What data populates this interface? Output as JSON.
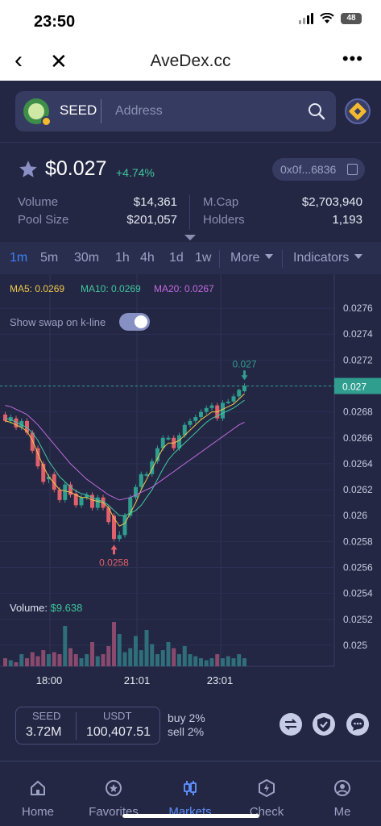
{
  "status_bar": {
    "time": "23:50",
    "battery": "48"
  },
  "browser": {
    "title": "AveDex.cc",
    "back_icon": "chevron-left-icon",
    "close_icon": "close-icon",
    "more_label": "•••"
  },
  "search": {
    "token": "SEED",
    "placeholder": "Address"
  },
  "price": {
    "value": "$0.027",
    "change": "+4.74%",
    "address": "0x0f...6836"
  },
  "stats": {
    "volume_label": "Volume",
    "volume": "$14,361",
    "pool_label": "Pool Size",
    "pool": "$201,057",
    "mcap_label": "M.Cap",
    "mcap": "$2,703,940",
    "holders_label": "Holders",
    "holders": "1,193"
  },
  "tabs": {
    "items": [
      "1m",
      "5m",
      "30m",
      "1h",
      "4h",
      "1d",
      "1w"
    ],
    "active": "1m",
    "more": "More",
    "indicators": "Indicators"
  },
  "chart": {
    "ma5": "MA5: 0.0269",
    "ma10": "MA10: 0.0269",
    "ma20": "MA20: 0.0267",
    "swap_label": "Show swap on k-line",
    "swap_toggle_on": true,
    "volume_prefix": "Volume: ",
    "volume_value": "$9.638",
    "high_marker": "0.027",
    "low_marker": "0.0258",
    "current_tag": "0.027",
    "colors": {
      "up": "#2f9e8f",
      "down": "#e0606b",
      "ma5": "#f0c94a",
      "ma10": "#41c8a0",
      "ma20": "#c26ae0"
    }
  },
  "chart_data": {
    "type": "candlestick",
    "y_ticks": [
      "0.0276",
      "0.0274",
      "0.0272",
      "0.0270",
      "0.0268",
      "0.0266",
      "0.0264",
      "0.0262",
      "0.026",
      "0.0258",
      "0.0256",
      "0.0254",
      "0.0252",
      "0.025"
    ],
    "x_ticks": [
      "18:00",
      "21:01",
      "23:01"
    ],
    "candles": [
      {
        "o": 0.02678,
        "c": 0.02673,
        "h": 0.0268,
        "l": 0.02672
      },
      {
        "o": 0.02673,
        "c": 0.02676,
        "h": 0.02678,
        "l": 0.02671
      },
      {
        "o": 0.02675,
        "c": 0.02668,
        "h": 0.02677,
        "l": 0.02666
      },
      {
        "o": 0.02668,
        "c": 0.02673,
        "h": 0.02675,
        "l": 0.02666
      },
      {
        "o": 0.02673,
        "c": 0.02664,
        "h": 0.02675,
        "l": 0.02662
      },
      {
        "o": 0.02664,
        "c": 0.0265,
        "h": 0.02666,
        "l": 0.02648
      },
      {
        "o": 0.02652,
        "c": 0.02638,
        "h": 0.02654,
        "l": 0.02636
      },
      {
        "o": 0.0264,
        "c": 0.02626,
        "h": 0.02642,
        "l": 0.02624
      },
      {
        "o": 0.02628,
        "c": 0.0263,
        "h": 0.02632,
        "l": 0.02625
      },
      {
        "o": 0.02632,
        "c": 0.0262,
        "h": 0.02634,
        "l": 0.02618
      },
      {
        "o": 0.0262,
        "c": 0.02612,
        "h": 0.02622,
        "l": 0.0261
      },
      {
        "o": 0.02612,
        "c": 0.02624,
        "h": 0.02626,
        "l": 0.0261
      },
      {
        "o": 0.02624,
        "c": 0.02616,
        "h": 0.02626,
        "l": 0.02614
      },
      {
        "o": 0.02617,
        "c": 0.02608,
        "h": 0.0262,
        "l": 0.02606
      },
      {
        "o": 0.02608,
        "c": 0.02614,
        "h": 0.02616,
        "l": 0.02606
      },
      {
        "o": 0.02614,
        "c": 0.02616,
        "h": 0.02618,
        "l": 0.02612
      },
      {
        "o": 0.02616,
        "c": 0.02606,
        "h": 0.02618,
        "l": 0.02604
      },
      {
        "o": 0.02606,
        "c": 0.02614,
        "h": 0.02616,
        "l": 0.02604
      },
      {
        "o": 0.02614,
        "c": 0.02606,
        "h": 0.02616,
        "l": 0.02604
      },
      {
        "o": 0.02606,
        "c": 0.02595,
        "h": 0.02608,
        "l": 0.02593
      },
      {
        "o": 0.026,
        "c": 0.02582,
        "h": 0.02602,
        "l": 0.0258
      },
      {
        "o": 0.02582,
        "c": 0.02585,
        "h": 0.02588,
        "l": 0.0258
      },
      {
        "o": 0.02585,
        "c": 0.026,
        "h": 0.02602,
        "l": 0.02583
      },
      {
        "o": 0.026,
        "c": 0.02614,
        "h": 0.02616,
        "l": 0.02598
      },
      {
        "o": 0.02614,
        "c": 0.02622,
        "h": 0.02624,
        "l": 0.02612
      },
      {
        "o": 0.02622,
        "c": 0.02632,
        "h": 0.02634,
        "l": 0.0262
      },
      {
        "o": 0.02632,
        "c": 0.02632,
        "h": 0.02634,
        "l": 0.0263
      },
      {
        "o": 0.02632,
        "c": 0.02642,
        "h": 0.02644,
        "l": 0.0263
      },
      {
        "o": 0.02642,
        "c": 0.02652,
        "h": 0.02654,
        "l": 0.0264
      },
      {
        "o": 0.02652,
        "c": 0.0266,
        "h": 0.02662,
        "l": 0.0265
      },
      {
        "o": 0.0266,
        "c": 0.0266,
        "h": 0.02662,
        "l": 0.02658
      },
      {
        "o": 0.0266,
        "c": 0.02652,
        "h": 0.02662,
        "l": 0.0265
      },
      {
        "o": 0.02652,
        "c": 0.02662,
        "h": 0.02664,
        "l": 0.0265
      },
      {
        "o": 0.02662,
        "c": 0.0267,
        "h": 0.02672,
        "l": 0.0266
      },
      {
        "o": 0.0267,
        "c": 0.02673,
        "h": 0.02675,
        "l": 0.02668
      },
      {
        "o": 0.02673,
        "c": 0.02676,
        "h": 0.02678,
        "l": 0.02671
      },
      {
        "o": 0.02676,
        "c": 0.0268,
        "h": 0.02682,
        "l": 0.02674
      },
      {
        "o": 0.0268,
        "c": 0.02683,
        "h": 0.02685,
        "l": 0.02678
      },
      {
        "o": 0.02683,
        "c": 0.02685,
        "h": 0.02687,
        "l": 0.02681
      },
      {
        "o": 0.02685,
        "c": 0.02675,
        "h": 0.02687,
        "l": 0.02673
      },
      {
        "o": 0.02675,
        "c": 0.02687,
        "h": 0.02689,
        "l": 0.02673
      },
      {
        "o": 0.02687,
        "c": 0.02688,
        "h": 0.0269,
        "l": 0.02686
      },
      {
        "o": 0.02688,
        "c": 0.02692,
        "h": 0.02694,
        "l": 0.02686
      },
      {
        "o": 0.02692,
        "c": 0.02697,
        "h": 0.02698,
        "l": 0.0269
      },
      {
        "o": 0.02696,
        "c": 0.027,
        "h": 0.02702,
        "l": 0.02695
      }
    ],
    "ma5": [
      0.02673,
      0.02672,
      0.0267,
      0.02668,
      0.02665,
      0.02658,
      0.02648,
      0.02638,
      0.0263,
      0.02625,
      0.0262,
      0.02619,
      0.02618,
      0.02616,
      0.02614,
      0.02614,
      0.02612,
      0.02611,
      0.0261,
      0.02606,
      0.02598,
      0.02592,
      0.02594,
      0.02602,
      0.0261,
      0.0262,
      0.02628,
      0.02636,
      0.02644,
      0.02652,
      0.02656,
      0.02656,
      0.02658,
      0.02662,
      0.02666,
      0.0267,
      0.02674,
      0.02677,
      0.0268,
      0.0268,
      0.02682,
      0.02684,
      0.02686,
      0.0269,
      0.02694
    ],
    "ma10": [
      0.02675,
      0.02674,
      0.02672,
      0.0267,
      0.02668,
      0.02664,
      0.02658,
      0.0265,
      0.02642,
      0.02636,
      0.0263,
      0.02626,
      0.02622,
      0.02619,
      0.02617,
      0.02616,
      0.02614,
      0.02612,
      0.02611,
      0.02608,
      0.02604,
      0.026,
      0.026,
      0.02602,
      0.02604,
      0.02608,
      0.02614,
      0.0262,
      0.02628,
      0.02636,
      0.02643,
      0.02648,
      0.02652,
      0.02656,
      0.0266,
      0.02664,
      0.02668,
      0.02672,
      0.02675,
      0.02677,
      0.02679,
      0.02681,
      0.02683,
      0.02686,
      0.02689
    ],
    "ma20": [
      0.02685,
      0.02684,
      0.02682,
      0.0268,
      0.02678,
      0.02674,
      0.0267,
      0.02665,
      0.0266,
      0.02655,
      0.0265,
      0.02645,
      0.0264,
      0.02636,
      0.02632,
      0.02628,
      0.02625,
      0.02622,
      0.02619,
      0.02616,
      0.02614,
      0.02612,
      0.02613,
      0.02614,
      0.02616,
      0.02618,
      0.0262,
      0.02622,
      0.02625,
      0.02628,
      0.02631,
      0.02634,
      0.02637,
      0.0264,
      0.02643,
      0.02646,
      0.02649,
      0.02652,
      0.02655,
      0.02658,
      0.02661,
      0.02664,
      0.02667,
      0.0267,
      0.02672
    ],
    "volumes": [
      0.2,
      0.15,
      0.1,
      0.3,
      0.2,
      0.35,
      0.25,
      0.4,
      0.3,
      0.35,
      0.3,
      1.0,
      0.45,
      0.3,
      0.2,
      0.3,
      0.6,
      0.25,
      0.3,
      0.5,
      1.1,
      0.8,
      0.35,
      0.45,
      0.75,
      0.4,
      0.9,
      0.55,
      0.3,
      0.4,
      0.6,
      0.45,
      0.3,
      0.5,
      0.3,
      0.25,
      0.2,
      0.15,
      0.2,
      0.3,
      0.2,
      0.25,
      0.2,
      0.3,
      0.2
    ],
    "y_min": 0.0249,
    "y_max": 0.0277
  },
  "trade": {
    "base_label": "SEED",
    "base_value": "3.72M",
    "quote_label": "USDT",
    "quote_value": "100,407.51",
    "buy_fee": "buy 2%",
    "sell_fee": "sell 2%"
  },
  "bottom_nav": [
    {
      "label": "Home",
      "icon": "home-icon"
    },
    {
      "label": "Favorites",
      "icon": "favorites-icon"
    },
    {
      "label": "Markets",
      "icon": "markets-icon",
      "active": true
    },
    {
      "label": "Check",
      "icon": "check-icon"
    },
    {
      "label": "Me",
      "icon": "me-icon"
    }
  ]
}
